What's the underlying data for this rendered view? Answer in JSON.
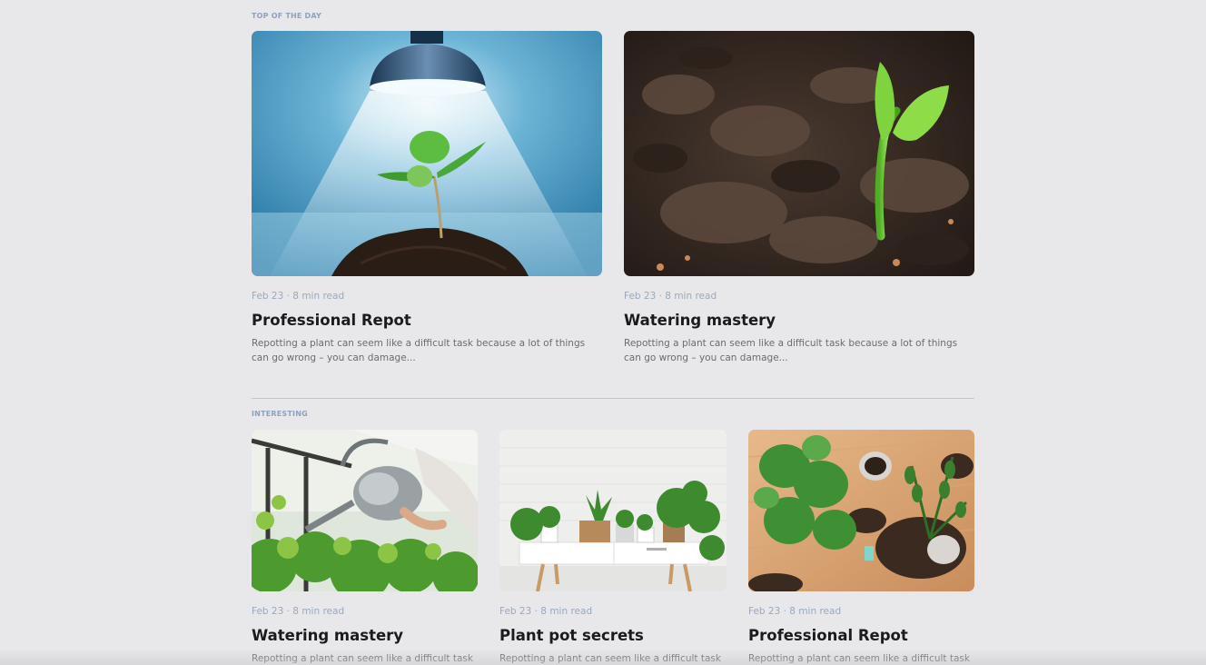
{
  "sections": {
    "top": {
      "label": "TOP OF THE DAY",
      "cards": [
        {
          "meta": "Feb 23 · 8 min read",
          "title": "Professional Repot",
          "excerpt": "Repotting a plant can seem like a difficult task because a lot of things can go wrong – you can damage..."
        },
        {
          "meta": "Feb 23 · 8 min read",
          "title": "Watering mastery",
          "excerpt": "Repotting a plant can seem like a difficult task because a lot of things can go wrong – you can damage..."
        }
      ]
    },
    "interesting": {
      "label": "INTERESTING",
      "cards": [
        {
          "meta": "Feb 23 · 8 min read",
          "title": "Watering mastery",
          "excerpt": "Repotting a plant can seem like a difficult task"
        },
        {
          "meta": "Feb 23 · 8 min read",
          "title": "Plant pot secrets",
          "excerpt": "Repotting a plant can seem like a difficult task"
        },
        {
          "meta": "Feb 23 · 8 min read",
          "title": "Professional Repot",
          "excerpt": "Repotting a plant can seem like a difficult task"
        }
      ]
    }
  },
  "colors": {
    "background": "#e8e7ea",
    "label": "#8fa2bd",
    "meta": "#9aa9bf",
    "title": "#1b1b1b",
    "excerpt": "#6c6c6c"
  }
}
